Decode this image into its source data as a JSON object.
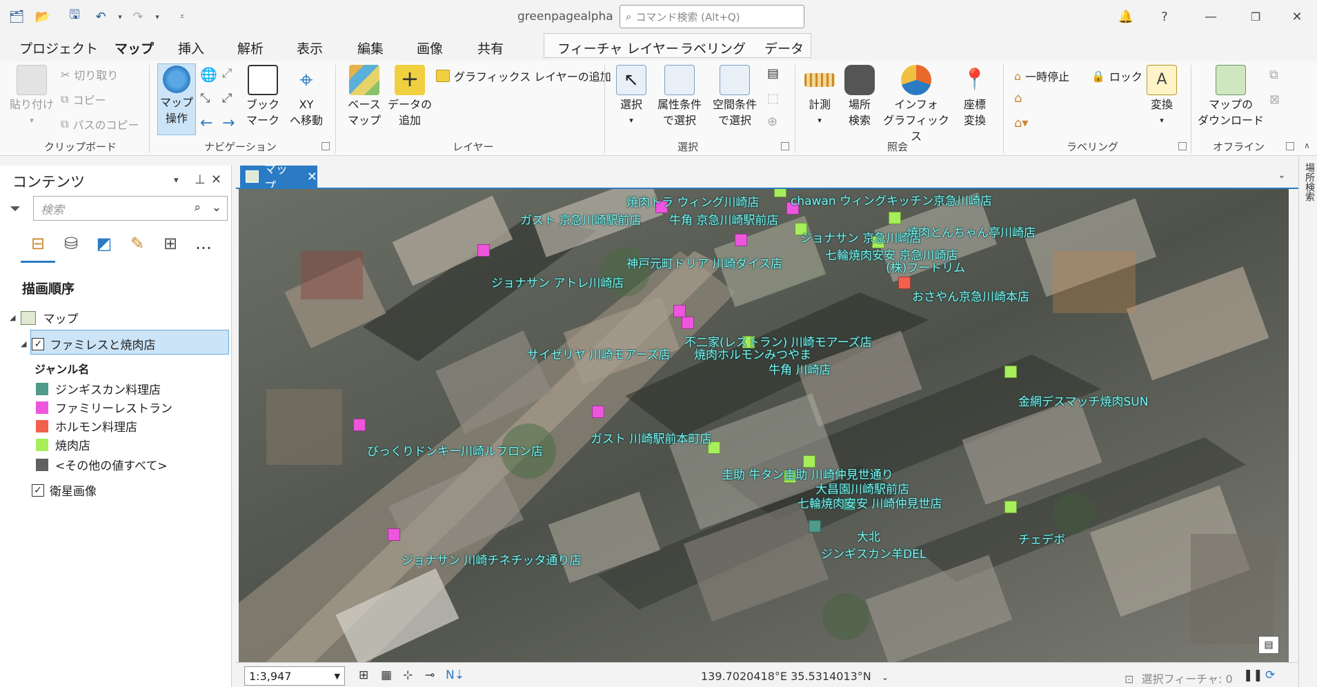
{
  "app": {
    "title": "greenpagealpha",
    "command_search_placeholder": "コマンド検索 (Alt+Q)"
  },
  "ribbon_tabs": [
    "プロジェクト",
    "マップ",
    "挿入",
    "解析",
    "表示",
    "編集",
    "画像",
    "共有"
  ],
  "ribbon_context_tabs": [
    "フィーチャ レイヤー",
    "ラベリング",
    "データ"
  ],
  "ribbon": {
    "clipboard": {
      "paste": "貼り付け",
      "cut": "切り取り",
      "copy": "コピー",
      "copy_path": "パスのコピー",
      "label": "クリップボード"
    },
    "navigation": {
      "explore_1": "マップ",
      "explore_2": "操作",
      "bookmarks_1": "ブック",
      "bookmarks_2": "マーク",
      "goto_1": "XY",
      "goto_2": "へ移動",
      "label": "ナビゲーション"
    },
    "layer": {
      "basemap_1": "ベース",
      "basemap_2": "マップ",
      "adddata_1": "データの",
      "adddata_2": "追加",
      "add_graphics": "グラフィックス レイヤーの追加",
      "label": "レイヤー"
    },
    "selection": {
      "select": "選択",
      "by_attr_1": "属性条件",
      "by_attr_2": "で選択",
      "by_loc_1": "空間条件",
      "by_loc_2": "で選択",
      "label": "選択"
    },
    "inquiry": {
      "measure": "計測",
      "locate_1": "場所",
      "locate_2": "検索",
      "infographics_1": "インフォ",
      "infographics_2": "グラフィックス",
      "coord_1": "座標",
      "coord_2": "変換",
      "label": "照会"
    },
    "labeling": {
      "pause": "一時停止",
      "lock": "ロック",
      "convert": "変換",
      "label": "ラベリング"
    },
    "offline": {
      "download_1": "マップの",
      "download_2": "ダウンロード",
      "label": "オフライン"
    }
  },
  "contents": {
    "title": "コンテンツ",
    "search_placeholder": "検索",
    "draw_order": "描画順序",
    "map_node": "マップ",
    "layer_name": "ファミレスと焼肉店",
    "genre_header": "ジャンル名",
    "legend": [
      {
        "label": "ジンギスカン料理店",
        "color": "#4f9a88"
      },
      {
        "label": "ファミリーレストラン",
        "color": "#ee55dd"
      },
      {
        "label": "ホルモン料理店",
        "color": "#f0604c"
      },
      {
        "label": "焼肉店",
        "color": "#a6ee5a"
      },
      {
        "label": "<その他の値すべて>",
        "color": "#606060"
      }
    ],
    "satellite_layer": "衛星画像"
  },
  "map_tab": {
    "label": "マップ"
  },
  "right_strip": {
    "label": "場所検索"
  },
  "map_labels": [
    {
      "text": "焼肉トラ ウィング川崎店"
    },
    {
      "text": "chawan ウィングキッチン京急川崎店"
    },
    {
      "text": "ガスト 京急川崎駅前店"
    },
    {
      "text": "牛角 京急川崎駅前店"
    },
    {
      "text": "ジョナサン 京急川崎店"
    },
    {
      "text": "焼肉とんちゃん亭川崎店"
    },
    {
      "text": "七輪焼肉安安 京急川崎店"
    },
    {
      "text": "神戸元町ドリア 川崎ダイス店"
    },
    {
      "text": "(株)フードリム"
    },
    {
      "text": "ジョナサン アトレ川崎店"
    },
    {
      "text": "おさやん京急川崎本店"
    },
    {
      "text": "不二家(レストラン) 川崎モアーズ店"
    },
    {
      "text": "サイゼリヤ 川崎モアーズ店"
    },
    {
      "text": "焼肉ホルモンみつやま"
    },
    {
      "text": "牛角 川崎店"
    },
    {
      "text": "金網デスマッチ焼肉SUN"
    },
    {
      "text": "ガスト 川崎駅前本町店"
    },
    {
      "text": "びっくりドンキー川崎ルフロン店"
    },
    {
      "text": "圭助 牛タン圭助 川崎仲見世通り"
    },
    {
      "text": "大昌園川崎駅前店"
    },
    {
      "text": "七輪焼肉安安 川崎仲見世店"
    },
    {
      "text": "大北"
    },
    {
      "text": "チェデボ"
    },
    {
      "text": "ジンギスカン羊DEL"
    },
    {
      "text": "ジョナサン 川崎チネチッタ通り店"
    }
  ],
  "statusbar": {
    "scale": "1:3,947",
    "coordinates": "139.7020418°E 35.5314013°N",
    "selected_features": "選択フィーチャ: 0"
  }
}
